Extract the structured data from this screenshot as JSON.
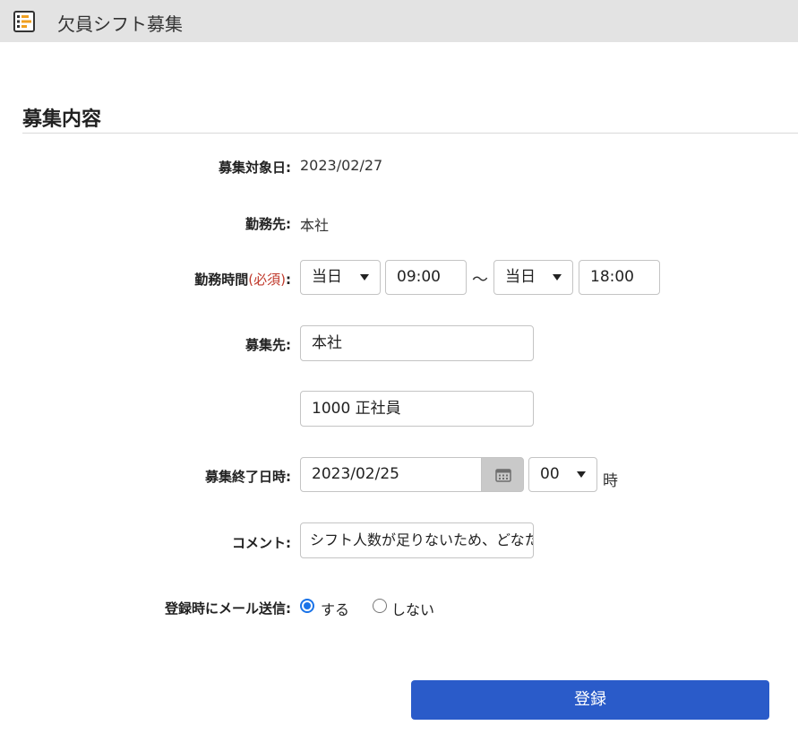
{
  "window": {
    "title": "欠員シフト募集"
  },
  "section": {
    "title": "募集内容"
  },
  "form": {
    "target_date": {
      "label": "募集対象日:",
      "value": "2023/02/27"
    },
    "workplace": {
      "label": "勤務先:",
      "value": "本社"
    },
    "work_time": {
      "label": "勤務時間",
      "required": "(必須)",
      "colon": ":",
      "start_day": "当日",
      "start_time": "09:00",
      "separator": "～",
      "end_day": "当日",
      "end_time": "18:00"
    },
    "recruit_target": {
      "label": "募集先:",
      "location": "本社",
      "employment_type": "1000 正社員"
    },
    "deadline": {
      "label": "募集終了日時:",
      "date": "2023/02/25",
      "hour": "00",
      "hour_unit": "時"
    },
    "comment": {
      "label": "コメント:",
      "value": "シフト人数が足りないため、どなたか"
    },
    "send_mail": {
      "label": "登録時にメール送信:",
      "options": [
        {
          "label": "する",
          "selected": true
        },
        {
          "label": "しない",
          "selected": false
        }
      ]
    },
    "submit_label": "登録"
  },
  "colors": {
    "titlebar_bg": "#e3e3e3",
    "primary_button": "#2a5bc9",
    "required_text": "#c0392b",
    "radio_accent": "#1a73e8"
  },
  "icons": {
    "app": "schedule-app-icon",
    "calendar": "calendar-icon",
    "dropdown": "chevron-down-icon"
  }
}
